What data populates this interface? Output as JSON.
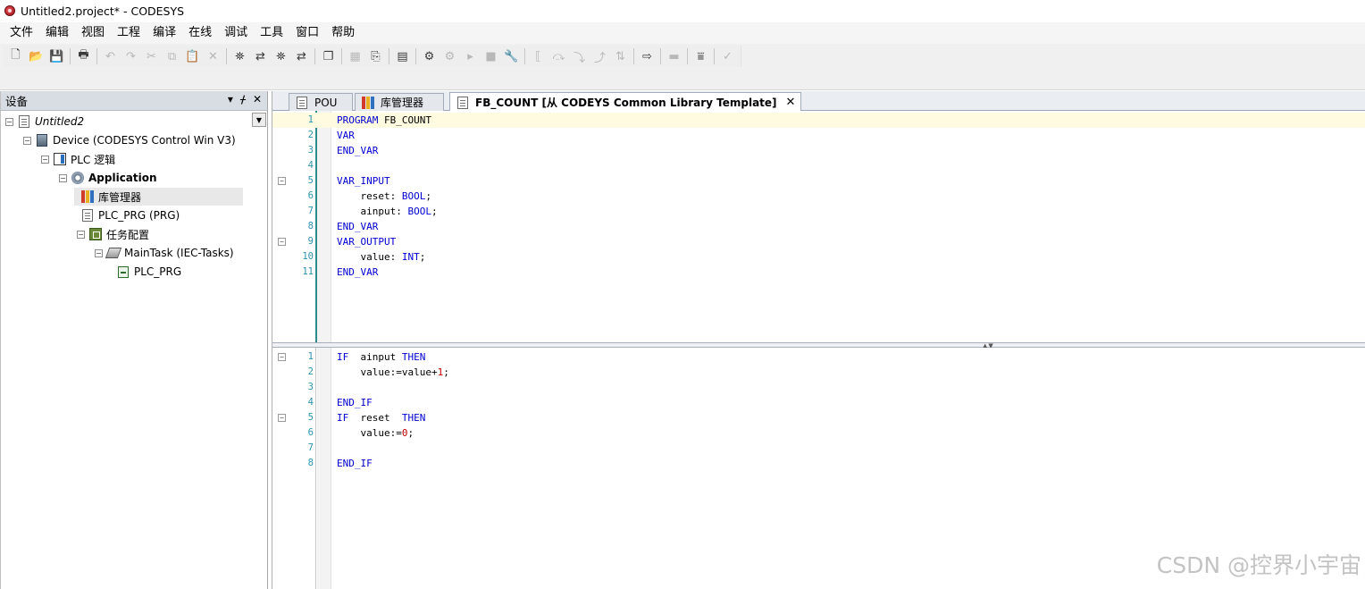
{
  "window": {
    "title": "Untitled2.project* - CODESYS"
  },
  "menu": [
    "文件",
    "编辑",
    "视图",
    "工程",
    "编译",
    "在线",
    "调试",
    "工具",
    "窗口",
    "帮助"
  ],
  "toolbar": [
    {
      "icon": "new-icon",
      "glyph": "🗋"
    },
    {
      "icon": "open-icon",
      "glyph": "📂"
    },
    {
      "icon": "save-icon",
      "glyph": "💾"
    },
    {
      "icon": "sep"
    },
    {
      "icon": "print-icon",
      "glyph": "🖶"
    },
    {
      "icon": "sep"
    },
    {
      "icon": "undo-icon",
      "glyph": "↶",
      "disabled": true
    },
    {
      "icon": "redo-icon",
      "glyph": "↷",
      "disabled": true
    },
    {
      "icon": "cut-icon",
      "glyph": "✂",
      "disabled": true
    },
    {
      "icon": "copy-icon",
      "glyph": "⧉",
      "disabled": true
    },
    {
      "icon": "paste-icon",
      "glyph": "📋",
      "disabled": true
    },
    {
      "icon": "delete-icon",
      "glyph": "✕",
      "disabled": true
    },
    {
      "icon": "sep"
    },
    {
      "icon": "find-icon",
      "glyph": "⛯"
    },
    {
      "icon": "replace-icon",
      "glyph": "⇄"
    },
    {
      "icon": "find-in-project-icon",
      "glyph": "⛯"
    },
    {
      "icon": "replace-in-project-icon",
      "glyph": "⇄"
    },
    {
      "icon": "sep"
    },
    {
      "icon": "windows-icon",
      "glyph": "❐"
    },
    {
      "icon": "sep"
    },
    {
      "icon": "grid-icon",
      "glyph": "▦",
      "disabled": true
    },
    {
      "icon": "insert-icon",
      "glyph": "⎘"
    },
    {
      "icon": "sep"
    },
    {
      "icon": "build-icon",
      "glyph": "▤"
    },
    {
      "icon": "sep"
    },
    {
      "icon": "login-icon",
      "glyph": "⚙"
    },
    {
      "icon": "logout-icon",
      "glyph": "⚙",
      "disabled": true
    },
    {
      "icon": "run-icon",
      "glyph": "▸",
      "disabled": true
    },
    {
      "icon": "stop-icon",
      "glyph": "■",
      "disabled": true
    },
    {
      "icon": "reset-icon",
      "glyph": "🔧"
    },
    {
      "icon": "sep"
    },
    {
      "icon": "breakpoint-icon",
      "glyph": "⟦",
      "disabled": true
    },
    {
      "icon": "step-over-icon",
      "glyph": "⤼",
      "disabled": true
    },
    {
      "icon": "step-into-icon",
      "glyph": "⤵",
      "disabled": true
    },
    {
      "icon": "step-out-icon",
      "glyph": "⤴",
      "disabled": true
    },
    {
      "icon": "force-icon",
      "glyph": "⇅",
      "disabled": true
    },
    {
      "icon": "sep"
    },
    {
      "icon": "write-values-icon",
      "glyph": "⇨"
    },
    {
      "icon": "sep"
    },
    {
      "icon": "monitor-icon",
      "glyph": "▬",
      "disabled": true
    },
    {
      "icon": "sep"
    },
    {
      "icon": "filter-icon",
      "glyph": "⩸"
    },
    {
      "icon": "sep"
    },
    {
      "icon": "check-icon",
      "glyph": "✓",
      "disabled": true
    }
  ],
  "devices_panel": {
    "title": "设备",
    "header_tools": [
      "▾",
      "ᚋ",
      "✕"
    ],
    "tree": [
      {
        "label": "Untitled2",
        "level": 0,
        "expander": "⊟",
        "icon": "project",
        "italic": true
      },
      {
        "label": "Device (CODESYS Control Win V3)",
        "level": 1,
        "expander": "⊟",
        "icon": "device"
      },
      {
        "label": "PLC 逻辑",
        "level": 2,
        "expander": "⊟",
        "icon": "plc"
      },
      {
        "label": "Application",
        "level": 3,
        "expander": "⊟",
        "icon": "gear",
        "bold": true
      },
      {
        "label": "库管理器",
        "level": 4,
        "icon": "library",
        "selected": true
      },
      {
        "label": "PLC_PRG (PRG)",
        "level": 4,
        "icon": "page"
      },
      {
        "label": "任务配置",
        "level": 4,
        "expander": "⊟",
        "icon": "task"
      },
      {
        "label": "MainTask (IEC-Tasks)",
        "level": 5,
        "expander": "⊟",
        "icon": "maintask"
      },
      {
        "label": "PLC_PRG",
        "level": 6,
        "icon": "prgref"
      }
    ]
  },
  "editor": {
    "tabs": [
      {
        "label": "POU",
        "icon": "page"
      },
      {
        "label": "库管理器",
        "icon": "library"
      },
      {
        "label": "FB_COUNT [从 CODEYS Common Library Template]",
        "icon": "page",
        "active": true,
        "close": "✕"
      }
    ],
    "declaration": [
      {
        "n": "1",
        "text": [
          [
            "kw",
            "PROGRAM"
          ],
          [
            "t",
            " FB_COUNT"
          ]
        ],
        "current": true
      },
      {
        "n": "2",
        "text": [
          [
            "kw",
            "VAR"
          ]
        ]
      },
      {
        "n": "3",
        "text": [
          [
            "kw",
            "END_VAR"
          ]
        ]
      },
      {
        "n": "4",
        "text": []
      },
      {
        "n": "5",
        "fold": "⊟",
        "text": [
          [
            "kw",
            "VAR_INPUT"
          ]
        ]
      },
      {
        "n": "6",
        "text": [
          [
            "t",
            "    reset: "
          ],
          [
            "kw",
            "BOOL"
          ],
          [
            "t",
            ";"
          ]
        ]
      },
      {
        "n": "7",
        "text": [
          [
            "t",
            "    ainput: "
          ],
          [
            "kw",
            "BOOL"
          ],
          [
            "t",
            ";"
          ]
        ]
      },
      {
        "n": "8",
        "text": [
          [
            "kw",
            "END_VAR"
          ]
        ]
      },
      {
        "n": "9",
        "fold": "⊟",
        "text": [
          [
            "kw",
            "VAR_OUTPUT"
          ]
        ]
      },
      {
        "n": "10",
        "text": [
          [
            "t",
            "    value: "
          ],
          [
            "kw",
            "INT"
          ],
          [
            "t",
            ";"
          ]
        ]
      },
      {
        "n": "11",
        "text": [
          [
            "kw",
            "END_VAR"
          ]
        ]
      }
    ],
    "implementation": [
      {
        "n": "1",
        "fold": "⊟",
        "text": [
          [
            "kw",
            "IF"
          ],
          [
            "t",
            "  ainput "
          ],
          [
            "kw",
            "THEN"
          ]
        ]
      },
      {
        "n": "2",
        "text": [
          [
            "t",
            "    value:=value+"
          ],
          [
            "num",
            "1"
          ],
          [
            "t",
            ";"
          ]
        ]
      },
      {
        "n": "3",
        "text": []
      },
      {
        "n": "4",
        "text": [
          [
            "kw",
            "END_IF"
          ]
        ]
      },
      {
        "n": "5",
        "fold": "⊟",
        "text": [
          [
            "kw",
            "IF"
          ],
          [
            "t",
            "  reset  "
          ],
          [
            "kw",
            "THEN"
          ]
        ]
      },
      {
        "n": "6",
        "text": [
          [
            "t",
            "    value:="
          ],
          [
            "num",
            "0"
          ],
          [
            "t",
            ";"
          ]
        ]
      },
      {
        "n": "7",
        "text": []
      },
      {
        "n": "8",
        "text": [
          [
            "kw",
            "END_IF"
          ]
        ]
      }
    ],
    "splitter_handle": "▲▼"
  },
  "watermark": "CSDN @控界小宇宙",
  "colors": {
    "keyword": "#0000d0",
    "number": "#c00000",
    "line_number": "#2b91af",
    "current_line": "#fffbe0"
  }
}
